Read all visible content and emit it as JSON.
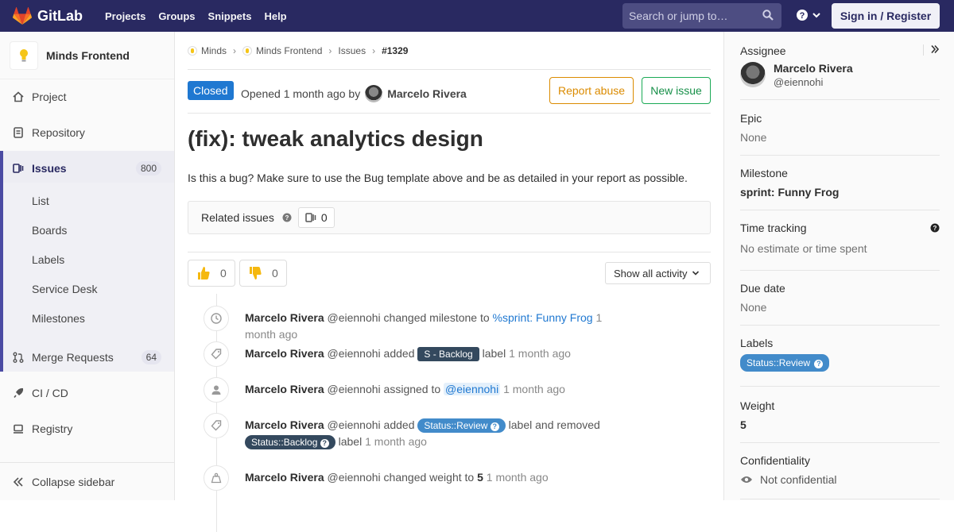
{
  "topbar": {
    "brand": "GitLab",
    "nav": [
      "Projects",
      "Groups",
      "Snippets",
      "Help"
    ],
    "search_placeholder": "Search or jump to…",
    "signin_label": "Sign in / Register"
  },
  "sidebar": {
    "project_name": "Minds Frontend",
    "items": [
      {
        "label": "Project"
      },
      {
        "label": "Repository"
      },
      {
        "label": "Issues",
        "count": "800"
      },
      {
        "label": "Merge Requests",
        "count": "64"
      },
      {
        "label": "CI / CD"
      },
      {
        "label": "Registry"
      }
    ],
    "issues_sub": [
      "List",
      "Boards",
      "Labels",
      "Service Desk",
      "Milestones"
    ],
    "collapse_label": "Collapse sidebar"
  },
  "breadcrumb": {
    "items": [
      "Minds",
      "Minds Frontend",
      "Issues",
      "#1329"
    ]
  },
  "issue": {
    "status": "Closed",
    "opened_text": "Opened 1 month ago by",
    "author": "Marcelo Rivera",
    "report_label": "Report abuse",
    "new_issue_label": "New issue",
    "title": "(fix): tweak analytics design",
    "description": "Is this a bug? Make sure to use the Bug template above and be as detailed in your report as possible.",
    "related_label": "Related issues",
    "related_count": "0",
    "thumbs_up": "0",
    "thumbs_down": "0",
    "show_activity": "Show all activity"
  },
  "activity": [
    {
      "author": "Marcelo Rivera",
      "handle": "@eiennohi",
      "a": "changed milestone to",
      "link": "%sprint: Funny Frog",
      "time": "1 month ago"
    },
    {
      "author": "Marcelo Rivera",
      "handle": "@eiennohi",
      "a": "added",
      "label": "S - Backlog",
      "b": "label",
      "time": "1 month ago"
    },
    {
      "author": "Marcelo Rivera",
      "handle": "@eiennohi",
      "a": "assigned to",
      "link": "@eiennohi",
      "time": "1 month ago"
    },
    {
      "author": "Marcelo Rivera",
      "handle": "@eiennohi",
      "a": "added",
      "label": "Status::Review",
      "b": "label and removed",
      "label2": "Status::Backlog",
      "c": "label",
      "time": "1 month ago"
    },
    {
      "author": "Marcelo Rivera",
      "handle": "@eiennohi",
      "a": "changed weight to",
      "value": "5",
      "time": "1 month ago"
    }
  ],
  "right": {
    "assignee_title": "Assignee",
    "assignee_name": "Marcelo Rivera",
    "assignee_handle": "@eiennohi",
    "epic_title": "Epic",
    "epic_value": "None",
    "milestone_title": "Milestone",
    "milestone_value": "sprint: Funny Frog",
    "time_title": "Time tracking",
    "time_value": "No estimate or time spent",
    "due_title": "Due date",
    "due_value": "None",
    "labels_title": "Labels",
    "label_value": "Status::Review",
    "weight_title": "Weight",
    "weight_value": "5",
    "conf_title": "Confidentiality",
    "conf_value": "Not confidential"
  },
  "colors": {
    "nav": "#292961",
    "closed": "#1f78d1",
    "label_dark": "#34495e",
    "label_review": "#428bca"
  }
}
